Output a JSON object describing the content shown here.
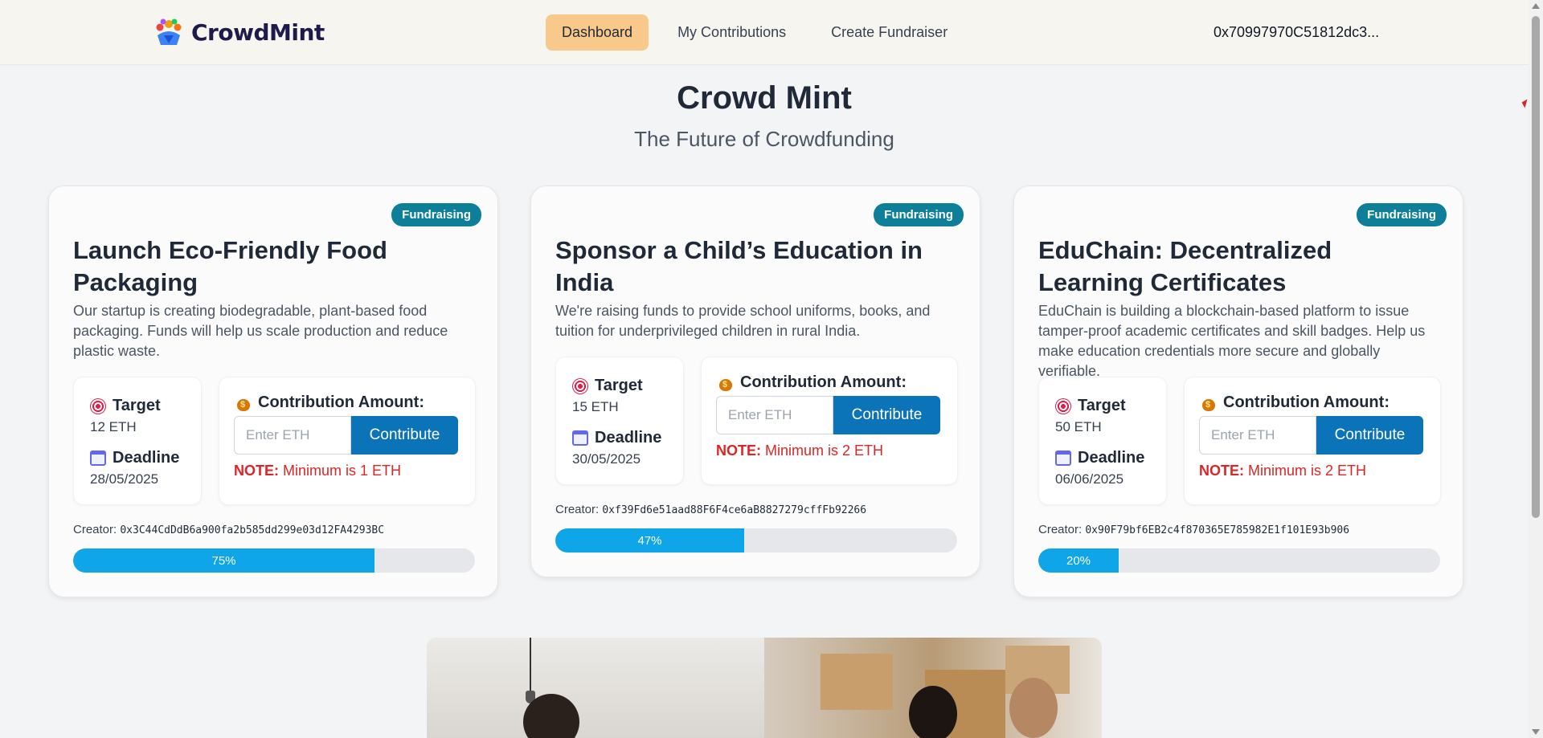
{
  "nav": {
    "brand": "CrowdMint",
    "links": [
      {
        "label": "Dashboard",
        "active": true
      },
      {
        "label": "My Contributions",
        "active": false
      },
      {
        "label": "Create Fundraiser",
        "active": false
      }
    ],
    "wallet": "0x70997970C51812dc3..."
  },
  "hero": {
    "title": "Crowd Mint",
    "subtitle": "The Future of Crowdfunding"
  },
  "campaigns": [
    {
      "status": "Fundraising",
      "title": "Launch Eco-Friendly Food Packaging",
      "description": "Our startup is creating biodegradable, plant-based food packaging. Funds will help us scale production and reduce plastic waste.",
      "target_label": "Target",
      "target": "12 ETH",
      "deadline_label": "Deadline",
      "deadline": "28/05/2025",
      "contribution_label": "Contribution Amount:",
      "input_placeholder": "Enter ETH",
      "button_label": "Contribute",
      "note_prefix": "NOTE:",
      "note_text": "Minimum is 1 ETH",
      "creator_label": "Creator:",
      "creator": "0x3C44CdDdB6a900fa2b585dd299e03d12FA4293BC",
      "progress": 75,
      "progress_label": "75%"
    },
    {
      "status": "Fundraising",
      "title": "Sponsor a Child’s Education in India",
      "description": "We're raising funds to provide school uniforms, books, and tuition for underprivileged children in rural India.",
      "target_label": "Target",
      "target": "15 ETH",
      "deadline_label": "Deadline",
      "deadline": "30/05/2025",
      "contribution_label": "Contribution Amount:",
      "input_placeholder": "Enter ETH",
      "button_label": "Contribute",
      "note_prefix": "NOTE:",
      "note_text": "Minimum is 2 ETH",
      "creator_label": "Creator:",
      "creator": "0xf39Fd6e51aad88F6F4ce6aB8827279cffFb92266",
      "progress": 47,
      "progress_label": "47%"
    },
    {
      "status": "Fundraising",
      "title": "EduChain: Decentralized Learning Certificates",
      "description": "EduChain is building a blockchain-based platform to issue tamper-proof academic certificates and skill badges. Help us make education credentials more secure and globally verifiable.",
      "target_label": "Target",
      "target": "50 ETH",
      "deadline_label": "Deadline",
      "deadline": "06/06/2025",
      "contribution_label": "Contribution Amount:",
      "input_placeholder": "Enter ETH",
      "button_label": "Contribute",
      "note_prefix": "NOTE:",
      "note_text": "Minimum is 2 ETH",
      "creator_label": "Creator:",
      "creator": "0x90F79bf6EB2c4f870365E785982E1f101E93b906",
      "progress": 20,
      "progress_label": "20%"
    }
  ],
  "colors": {
    "accent": "#0b73b8",
    "badge": "#0e7f98",
    "progress": "#0ea5e9",
    "active_nav": "#f8c98a",
    "note": "#dc2626"
  }
}
